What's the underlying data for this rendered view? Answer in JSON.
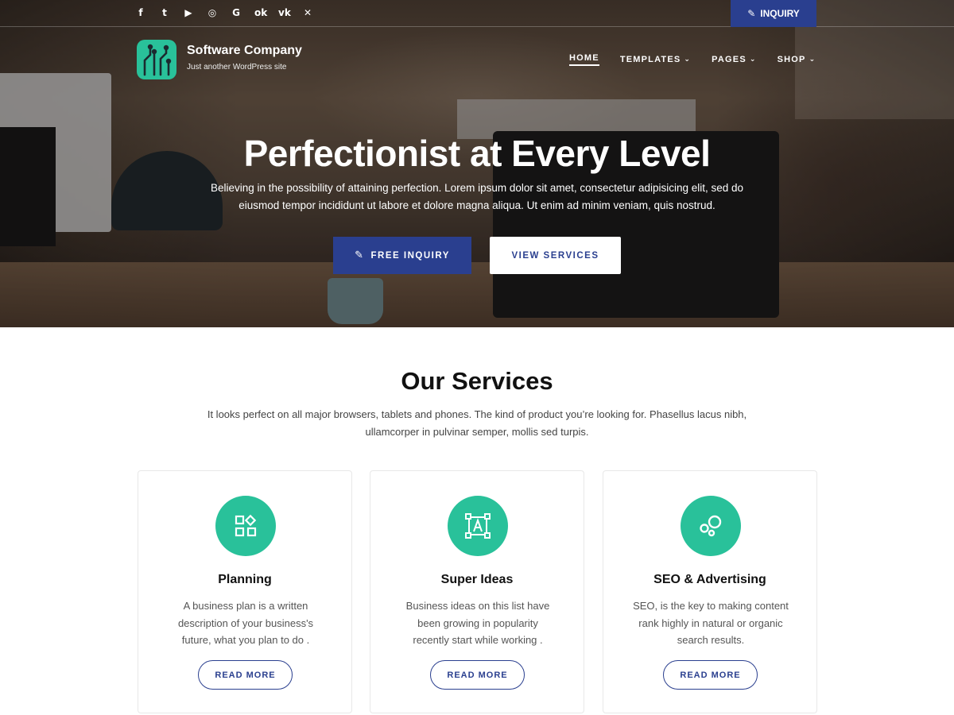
{
  "topbar": {
    "social": [
      {
        "icon": "facebook-icon",
        "glyph": "f"
      },
      {
        "icon": "twitter-icon",
        "glyph": "t"
      },
      {
        "icon": "youtube-icon",
        "glyph": "▶"
      },
      {
        "icon": "instagram-icon",
        "glyph": "◎"
      },
      {
        "icon": "google-plus-icon",
        "glyph": "G"
      },
      {
        "icon": "odnoklassniki-icon",
        "glyph": "ok"
      },
      {
        "icon": "vk-icon",
        "glyph": "vk"
      },
      {
        "icon": "xing-icon",
        "glyph": "✕"
      }
    ],
    "inquiry_label": "INQUIRY"
  },
  "header": {
    "brand_name": "Software Company",
    "tagline": "Just another WordPress site",
    "nav": [
      {
        "label": "HOME",
        "active": true,
        "dropdown": false
      },
      {
        "label": "TEMPLATES",
        "active": false,
        "dropdown": true
      },
      {
        "label": "PAGES",
        "active": false,
        "dropdown": true
      },
      {
        "label": "SHOP",
        "active": false,
        "dropdown": true
      }
    ]
  },
  "hero": {
    "title": "Perfectionist at Every Level",
    "subtitle": "Believing in the possibility of attaining perfection. Lorem ipsum dolor sit amet, consectetur adipisicing elit, sed do eiusmod tempor incididunt ut labore et dolore magna aliqua. Ut enim ad minim veniam, quis nostrud.",
    "primary_button": "FREE INQUIRY",
    "secondary_button": "VIEW SERVICES"
  },
  "services": {
    "title": "Our Services",
    "subtitle": "It looks perfect on all major browsers, tablets and phones. The kind of product you’re looking for. Phasellus lacus nibh, ullamcorper in pulvinar semper, mollis sed turpis.",
    "cards": [
      {
        "icon": "planning-icon",
        "title": "Planning",
        "text": "A business plan is a written description of your business's future, what you plan to do .",
        "button": "READ MORE"
      },
      {
        "icon": "super-ideas-icon",
        "title": "Super Ideas",
        "text": "Business ideas on this list have been growing in popularity recently start while working .",
        "button": "READ MORE"
      },
      {
        "icon": "seo-advertising-icon",
        "title": "SEO & Advertising",
        "text": "SEO, is the key to making content rank highly in natural or organic search results.",
        "button": "READ MORE"
      }
    ]
  },
  "colors": {
    "accent_blue": "#2a3f8f",
    "accent_green": "#29c19a"
  }
}
